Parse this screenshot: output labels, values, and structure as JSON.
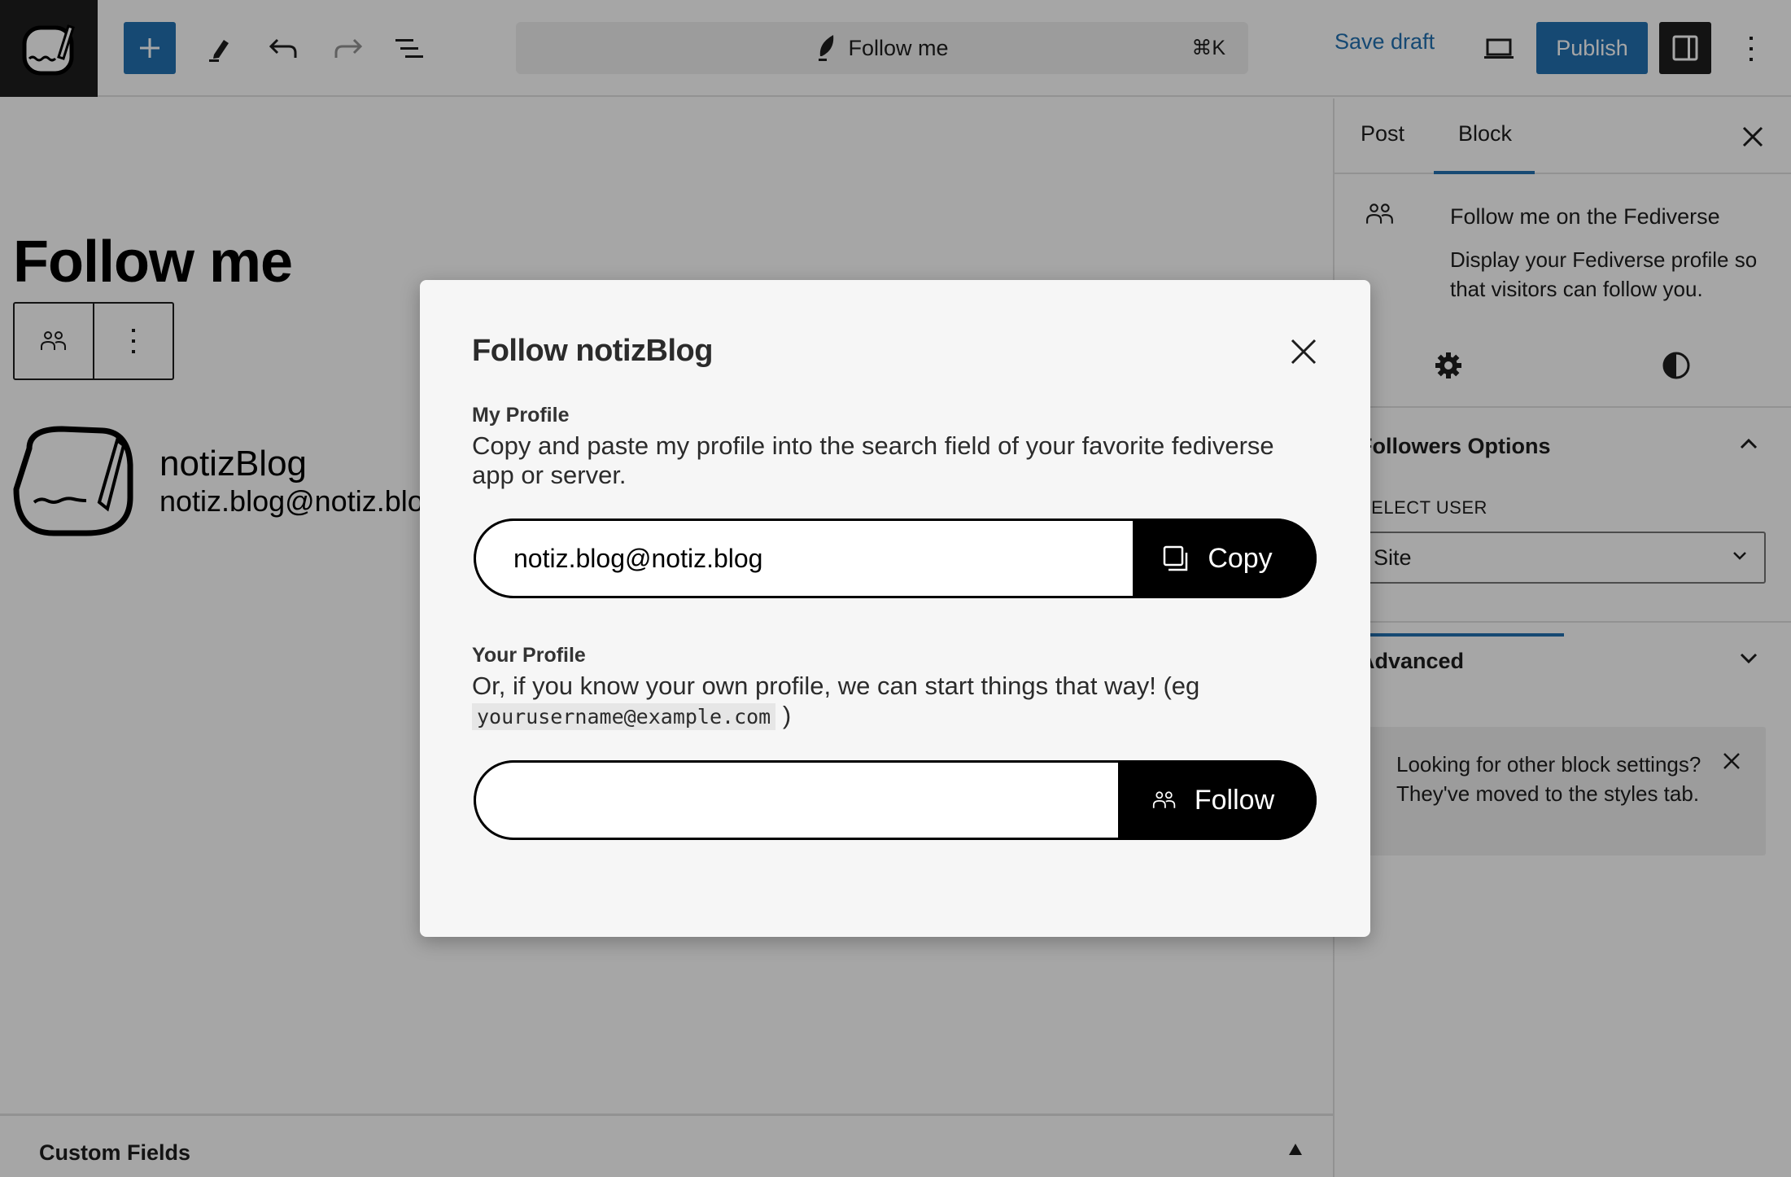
{
  "topbar": {
    "site_icon": "notizblog-logo-icon",
    "inserter_icon": "plus-icon",
    "tools": [
      "pencil-icon",
      "undo-icon",
      "redo-icon",
      "list-view-icon"
    ],
    "command_bar": {
      "icon": "feather-icon",
      "title": "Follow me",
      "shortcut": "⌘K"
    },
    "save_draft_label": "Save draft",
    "preview_icon": "laptop-icon",
    "publish_label": "Publish",
    "settings_icon": "sidebar-toggle-icon",
    "more_icon": "vertical-ellipsis-icon"
  },
  "canvas": {
    "post_title": "Follow me",
    "block_toolbar": {
      "block_icon": "people-icon",
      "options_icon": "vertical-ellipsis-icon"
    },
    "profile": {
      "name": "notizBlog",
      "handle": "notiz.blog@notiz.blog"
    },
    "custom_fields_label": "Custom Fields"
  },
  "sidebar": {
    "tabs": [
      {
        "label": "Post",
        "active": false
      },
      {
        "label": "Block",
        "active": true
      }
    ],
    "block_card": {
      "title": "Follow me on the Fediverse",
      "description": "Display your Fediverse profile so that visitors can follow you."
    },
    "subtabs": [
      {
        "name": "settings",
        "icon": "gear-icon",
        "active": true
      },
      {
        "name": "styles",
        "icon": "contrast-icon",
        "active": false
      }
    ],
    "followers_options": {
      "title": "Followers Options",
      "expanded": true,
      "select_label": "SELECT USER",
      "select_value": "Site"
    },
    "advanced": {
      "title": "Advanced",
      "expanded": false
    },
    "notice": {
      "text": "Looking for other block settings? They've moved to the styles tab."
    }
  },
  "modal": {
    "title": "Follow notizBlog",
    "my_profile": {
      "label": "My Profile",
      "description": "Copy and paste my profile into the search field of your favorite fediverse app or server.",
      "value": "notiz.blog@notiz.blog",
      "button_label": "Copy"
    },
    "your_profile": {
      "label": "Your Profile",
      "description_prefix": "Or, if you know your own profile, we can start things that way! (eg",
      "example": "yourusername@example.com",
      "description_suffix": ")",
      "value": "",
      "button_label": "Follow"
    }
  },
  "colors": {
    "accent": "#2271b1",
    "dark": "#1e1e1e",
    "modal_bg": "#f6f6f6",
    "pill_button": "#000000"
  }
}
